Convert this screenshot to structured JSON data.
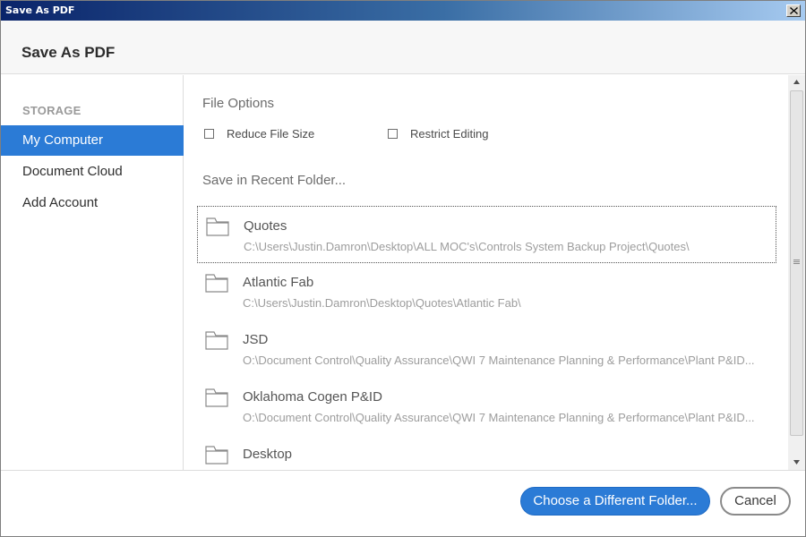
{
  "window": {
    "title": "Save As PDF"
  },
  "header": {
    "heading": "Save As PDF"
  },
  "sidebar": {
    "section_label": "STORAGE",
    "items": [
      {
        "label": "My Computer",
        "active": true
      },
      {
        "label": "Document Cloud",
        "active": false
      },
      {
        "label": "Add Account",
        "active": false
      }
    ]
  },
  "main": {
    "file_options_label": "File Options",
    "options": [
      {
        "label": "Reduce File Size",
        "checked": false
      },
      {
        "label": "Restrict Editing",
        "checked": false
      }
    ],
    "recent_label": "Save in Recent Folder...",
    "folders": [
      {
        "name": "Quotes",
        "path": "C:\\Users\\Justin.Damron\\Desktop\\ALL MOC's\\Controls System Backup Project\\Quotes\\",
        "selected": true
      },
      {
        "name": "Atlantic Fab",
        "path": "C:\\Users\\Justin.Damron\\Desktop\\Quotes\\Atlantic Fab\\",
        "selected": false
      },
      {
        "name": "JSD",
        "path": "O:\\Document Control\\Quality Assurance\\QWI 7 Maintenance Planning & Performance\\Plant P&ID...",
        "selected": false
      },
      {
        "name": "Oklahoma Cogen P&ID",
        "path": "O:\\Document Control\\Quality Assurance\\QWI 7 Maintenance Planning & Performance\\Plant P&ID...",
        "selected": false
      },
      {
        "name": "Desktop",
        "path": "",
        "selected": false
      }
    ]
  },
  "footer": {
    "choose_folder_label": "Choose a Different Folder...",
    "cancel_label": "Cancel"
  },
  "colors": {
    "accent": "#2b7bd6",
    "titlebar_start": "#0a246a",
    "titlebar_end": "#a6caf0"
  },
  "icons": {
    "close": "close-icon",
    "folder": "folder-icon",
    "scroll_up": "scroll-up-arrow-icon",
    "scroll_down": "scroll-down-arrow-icon"
  }
}
